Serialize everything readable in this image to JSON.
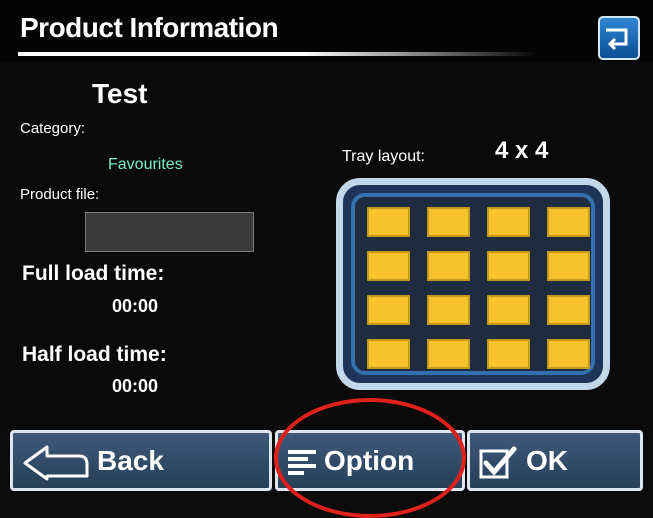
{
  "header": {
    "title": "Product Information",
    "back_icon": "return-icon"
  },
  "product": {
    "name": "Test",
    "category_label": "Category:",
    "category_value": "Favourites",
    "file_label": "Product file:",
    "file_value": "",
    "full_load_label": "Full load time:",
    "full_load_value": "00:00",
    "half_load_label": "Half load time:",
    "half_load_value": "00:00"
  },
  "tray": {
    "label": "Tray layout:",
    "size": "4 x 4",
    "rows": 4,
    "cols": 4,
    "slot_color": "#f6c32c"
  },
  "footer": {
    "buttons": [
      {
        "label": "Back",
        "icon": "arrow-left-icon"
      },
      {
        "label": "Option",
        "icon": "lines-icon"
      },
      {
        "label": "OK",
        "icon": "checkbox-icon"
      }
    ]
  },
  "annotation": {
    "color": "#e0211b"
  }
}
